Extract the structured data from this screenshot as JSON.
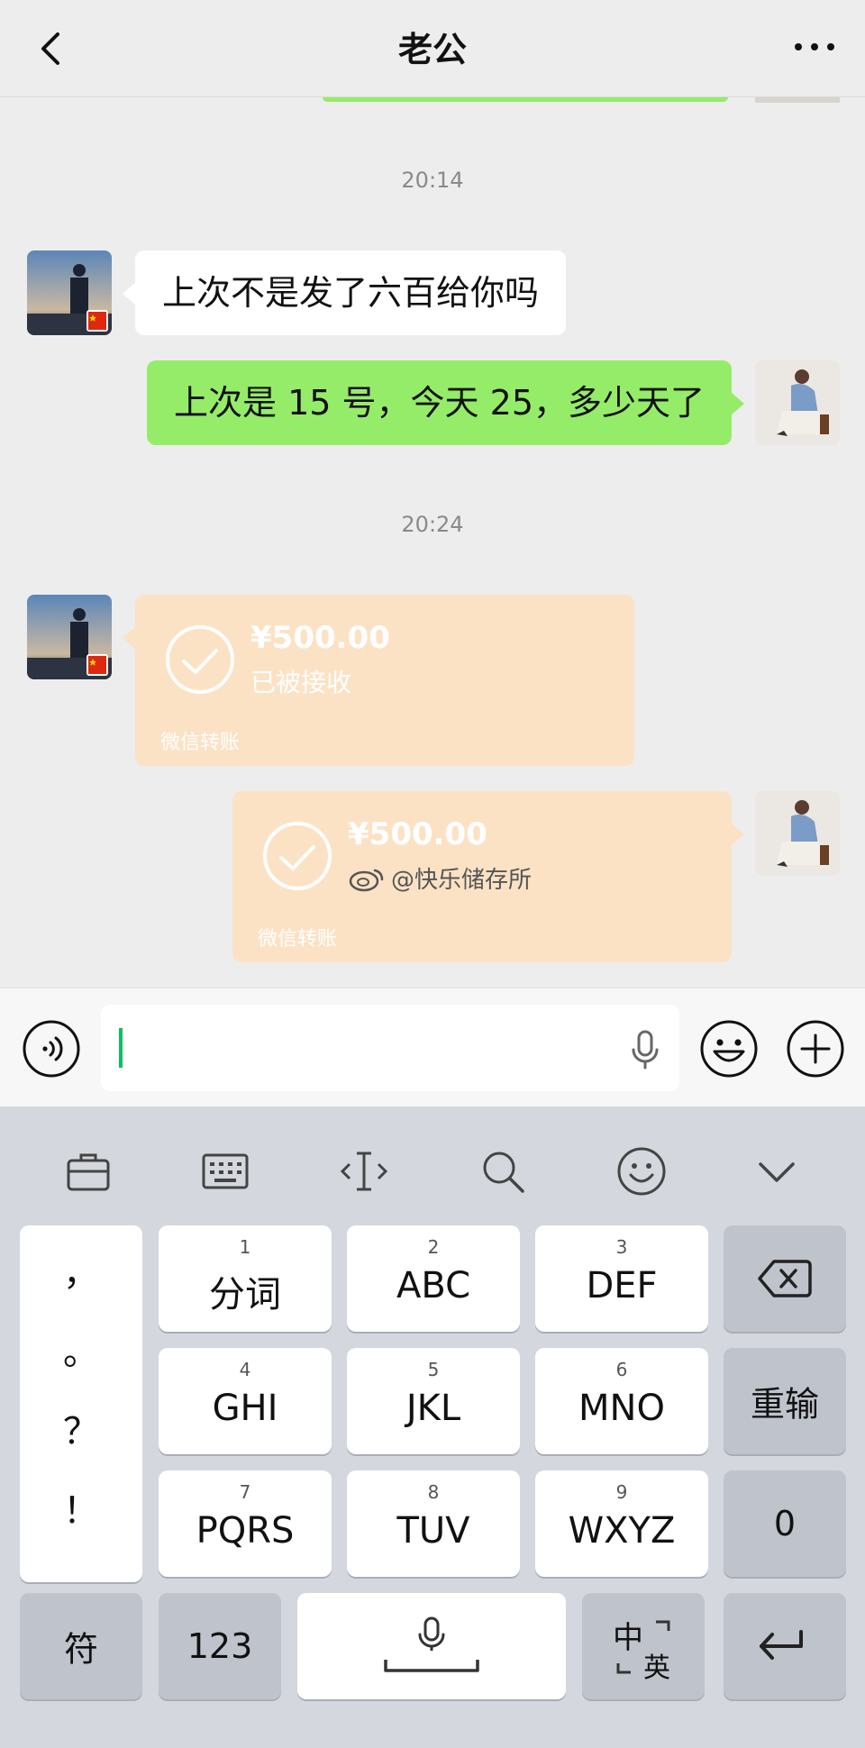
{
  "header": {
    "title": "老公",
    "back_icon": "chevron-left-icon",
    "more_icon": "more-dots-icon"
  },
  "chat": {
    "timestamps": [
      "20:14",
      "20:24"
    ],
    "messages": [
      {
        "sender": "other",
        "type": "text",
        "text": "上次不是发了六百给你吗"
      },
      {
        "sender": "self",
        "type": "text",
        "text": "上次是 15 号，今天 25，多少天了"
      },
      {
        "sender": "other",
        "type": "transfer",
        "amount": "¥500.00",
        "status": "已被接收",
        "label": "微信转账"
      },
      {
        "sender": "self",
        "type": "transfer",
        "amount": "¥500.00",
        "status": "",
        "label": "微信转账"
      }
    ],
    "watermark": "@快乐储存所"
  },
  "input_bar": {
    "value": "",
    "voice_icon": "voice-icon",
    "mic_icon": "mic-icon",
    "emoji_icon": "emoji-icon",
    "plus_icon": "plus-icon"
  },
  "keyboard": {
    "toolbar": [
      "briefcase-icon",
      "keyboard-icon",
      "text-cursor-icon",
      "search-icon",
      "smiley-icon",
      "chevron-down-icon"
    ],
    "punctuation": [
      "，",
      "。",
      "？",
      "！"
    ],
    "keys": [
      {
        "num": "1",
        "label": "分词"
      },
      {
        "num": "2",
        "label": "ABC"
      },
      {
        "num": "3",
        "label": "DEF"
      },
      {
        "num": "4",
        "label": "GHI"
      },
      {
        "num": "5",
        "label": "JKL"
      },
      {
        "num": "6",
        "label": "MNO"
      },
      {
        "num": "7",
        "label": "PQRS"
      },
      {
        "num": "8",
        "label": "TUV"
      },
      {
        "num": "9",
        "label": "WXYZ"
      }
    ],
    "reinput": "重输",
    "zero": "0",
    "symbols": "符",
    "num_mode": "123",
    "lang_zh": "中",
    "lang_en": "英",
    "backspace_icon": "backspace-icon",
    "enter_icon": "enter-icon",
    "space_mic_icon": "mic-icon"
  },
  "colors": {
    "green_bubble": "#95ec69",
    "transfer_peach": "#fce2c5",
    "cursor": "#07c160"
  }
}
